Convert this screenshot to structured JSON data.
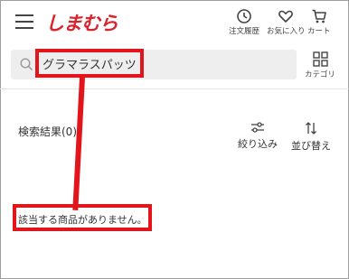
{
  "header": {
    "logo": "しまむら",
    "history_label": "注文履歴",
    "favorites_label": "お気に入り",
    "cart_label": "カート"
  },
  "search": {
    "value": "グラマラスパッツ"
  },
  "category": {
    "label": "カテゴリ"
  },
  "results": {
    "title": "検索結果(0)",
    "filter_label": "絞り込み",
    "sort_label": "並び替え",
    "empty_message": "該当する商品がありません。"
  },
  "colors": {
    "brand": "#d7242f",
    "highlight": "#e2141c",
    "search_bg": "#eeeeee"
  }
}
